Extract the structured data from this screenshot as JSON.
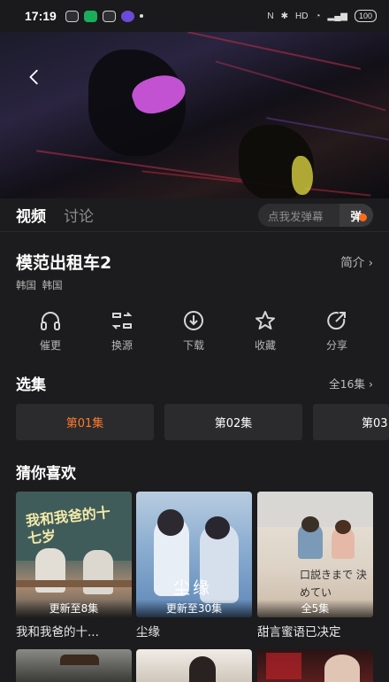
{
  "status_bar": {
    "time": "17:19",
    "battery": "100"
  },
  "tabs": {
    "video": "视频",
    "discuss": "讨论"
  },
  "danmu": {
    "placeholder": "点我发弹幕",
    "button": "弹"
  },
  "show": {
    "title": "模范出租车2",
    "intro_label": "简介 ›",
    "tags": "韩国  韩国"
  },
  "actions": [
    {
      "label": "催更",
      "icon": "headphones-icon"
    },
    {
      "label": "换源",
      "icon": "switch-source-icon"
    },
    {
      "label": "下载",
      "icon": "download-icon"
    },
    {
      "label": "收藏",
      "icon": "star-icon"
    },
    {
      "label": "分享",
      "icon": "share-icon"
    }
  ],
  "episodes": {
    "title": "选集",
    "all_label": "全16集 ›",
    "items": [
      "第01集",
      "第02集",
      "第03"
    ]
  },
  "recommend": {
    "title": "猜你喜欢",
    "items": [
      {
        "name": "我和我爸的十...",
        "status": "更新至8集",
        "poster_text": "我和我爸的十七岁"
      },
      {
        "name": "尘缘",
        "status": "更新至30集",
        "poster_text": "尘缘"
      },
      {
        "name": "甜言蜜语已决定",
        "status": "全5集",
        "poster_text": "口説きまで 決めてい"
      }
    ]
  },
  "colors": {
    "accent": "#ff7a2a",
    "background": "#1c1c1e"
  }
}
